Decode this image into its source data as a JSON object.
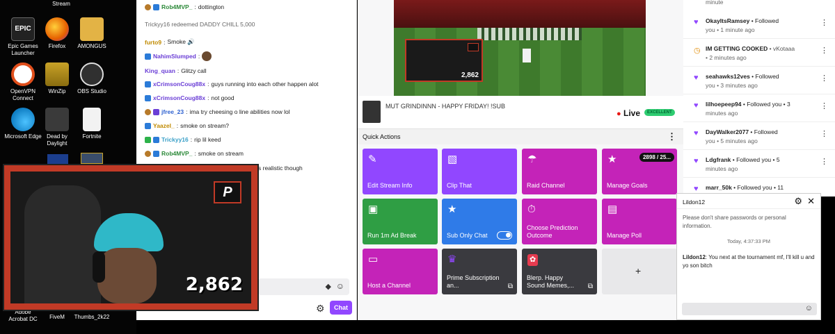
{
  "desktop": {
    "top_label": "Stream",
    "icons": [
      {
        "label": "Epic Games Launcher",
        "glyph": "EPIC",
        "color": "#222222"
      },
      {
        "label": "Firefox",
        "glyph": "FF",
        "color": "#e66000"
      },
      {
        "label": "AMONGUS",
        "glyph": "",
        "color": "#e3b345"
      },
      {
        "label": "OpenVPN Connect",
        "glyph": "VPN",
        "color": "#e04e1b"
      },
      {
        "label": "WinZip",
        "glyph": "ZIP",
        "color": "#c9a227"
      },
      {
        "label": "OBS Studio",
        "glyph": "OBS",
        "color": "#303030"
      },
      {
        "label": "Microsoft Edge",
        "glyph": "E",
        "color": "#0f7ec4"
      },
      {
        "label": "Dead by Daylight",
        "glyph": "DBD",
        "color": "#3a3a3a"
      },
      {
        "label": "Fortnite",
        "glyph": "",
        "color": "#f2f2f2"
      },
      {
        "label": "Adobe Acrobat DC",
        "glyph": "",
        "color": "#000000"
      },
      {
        "label": "FiveM",
        "glyph": "",
        "color": "#000000"
      },
      {
        "label": "Thumbs_2k22",
        "glyph": "",
        "color": "#000000"
      }
    ]
  },
  "chat": {
    "messages": [
      {
        "user": "Rob4MVP_",
        "sep": ":",
        "text": "dottington",
        "color": "#2d8a3a",
        "badge": "b-gold"
      },
      {
        "user": "",
        "sep": "",
        "text": "Trickyy16 redeemed DADDY CHILL   5,000",
        "color": "#666666",
        "badge": ""
      },
      {
        "user": "furto9",
        "sep": ":",
        "text": "Smoke 🔊",
        "color": "#c08a00",
        "badge": ""
      },
      {
        "user": "NahimSlumped",
        "sep": ":",
        "text": "",
        "color": "#6b3fd6",
        "badge": "b-blue"
      },
      {
        "user": "King_quan",
        "sep": ":",
        "text": "Glitzy call",
        "color": "#6b3fd6",
        "badge": ""
      },
      {
        "user": "xCrimsonCoug88x",
        "sep": ":",
        "text": "guys running into each other happen alot",
        "color": "#6b3fd6",
        "badge": "b-blue"
      },
      {
        "user": "xCrimsonCoug88x",
        "sep": ":",
        "text": "not good",
        "color": "#6b3fd6",
        "badge": "b-blue"
      },
      {
        "user": "jfree_23",
        "sep": ":",
        "text": "ima try cheesing o line abilities now lol",
        "color": "#2b5fcf",
        "badge": "b-purple"
      },
      {
        "user": "Yaazel_",
        "sep": ":",
        "text": "smoke on stream?",
        "color": "#c08a00",
        "badge": "b-blue"
      },
      {
        "user": "Trickyy16",
        "sep": ":",
        "text": "rip lil keed",
        "color": "#3aa0c8",
        "badge": "b-green"
      },
      {
        "user": "Rob4MVP_",
        "sep": ":",
        "text": "smoke on stream",
        "color": "#2d8a3a",
        "badge": "b-gold"
      },
      {
        "user": "",
        "sep": "",
        "text": "s realistic though",
        "color": "#222222",
        "badge": ""
      }
    ],
    "chat_button": "Chat"
  },
  "cam": {
    "count": "2,862",
    "logo": "P"
  },
  "video": {
    "count": "2,862"
  },
  "stream": {
    "title": "MUT GRINDINNN - HAPPY FRIDAY! !SUB",
    "live": "Live",
    "quality": "EXCELLENT"
  },
  "quick_actions": {
    "header": "Quick Actions",
    "tiles": [
      {
        "label": "Edit Stream Info",
        "color": "#9147ff",
        "icon": "✎"
      },
      {
        "label": "Clip That",
        "color": "#9147ff",
        "icon": "🎬"
      },
      {
        "label": "Raid Channel",
        "color": "#c423b8",
        "icon": "☂"
      },
      {
        "label": "Manage Goals",
        "color": "#c423b8",
        "icon": "★",
        "badge": "2898 / 25..."
      },
      {
        "label": "Run 1m Ad Break",
        "color": "#2f9e44",
        "icon": "▣"
      },
      {
        "label": "Sub Only Chat",
        "color": "#2f7be8",
        "icon": "★"
      },
      {
        "label": "Choose Prediction Outcome",
        "color": "#c423b8",
        "icon": "⏱"
      },
      {
        "label": "Manage Poll",
        "color": "#c423b8",
        "icon": "▤"
      },
      {
        "label": "Host a Channel",
        "color": "#c423b8",
        "icon": "▭"
      },
      {
        "label": "Prime Subscription an...",
        "color": "#3a3a3f",
        "icon": "♛"
      },
      {
        "label": "Blerp. Happy Sound Memes,...",
        "color": "#3a3a3f",
        "icon": "✿"
      },
      {
        "label": "+",
        "color": "#e8e8ea",
        "icon": ""
      }
    ]
  },
  "activity": {
    "first_sub": "minute",
    "items": [
      {
        "name": "OkayItsRamsey",
        "action": " • Followed",
        "sub": "you • 1 minute ago",
        "icon": "heart"
      },
      {
        "name": "IM GETTING COOKED",
        "action": " • vKotaaa",
        "sub": "• 2 minutes ago",
        "icon": "clock"
      },
      {
        "name": "seahawks12ves",
        "action": " • Followed",
        "sub": "you • 3 minutes ago",
        "icon": "heart"
      },
      {
        "name": "lilhoepeep94",
        "action": " • Followed you • 3",
        "sub": "minutes ago",
        "icon": "heart"
      },
      {
        "name": "DayWalker2077",
        "action": " • Followed",
        "sub": "you • 5 minutes ago",
        "icon": "heart"
      },
      {
        "name": "Ldgfrank",
        "action": " • Followed you • 5",
        "sub": "minutes ago",
        "icon": "heart"
      },
      {
        "name": "marr_50k",
        "action": " • Followed you • 11",
        "sub": "",
        "icon": "heart"
      }
    ]
  },
  "whisper": {
    "title": "Lildon12",
    "warning": "Please don't share passwords or personal information.",
    "timestamp": "Today, 4:37:33 PM",
    "from": "Lildon12",
    "message": ": You next at the tournament mf, I'll kill u and yo  son bitch"
  }
}
